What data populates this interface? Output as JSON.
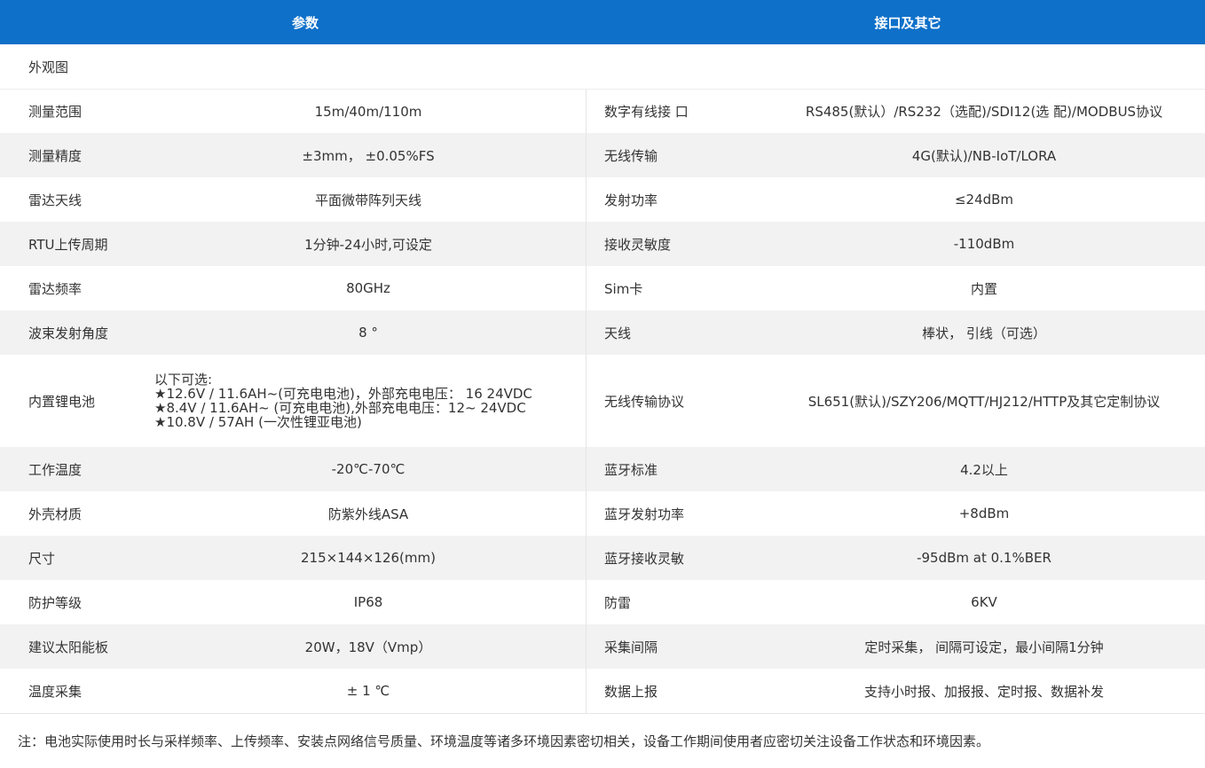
{
  "header": {
    "col1": "参数",
    "col2": "接口及其它"
  },
  "appearance_label": "外观图",
  "rows": [
    {
      "p": "测量范围",
      "v": "15m/40m/110m",
      "i": "数字有线接 口",
      "iv": "RS485(默认）/RS232（选配)/SDI12(选 配)/MODBUS协议"
    },
    {
      "p": "测量精度",
      "v": "±3mm， ±0.05%FS",
      "i": "无线传输",
      "iv": "4G(默认)/NB-IoT/LORA"
    },
    {
      "p": "雷达天线",
      "v": "平面微带阵列天线",
      "i": "发射功率",
      "iv": "≤24dBm"
    },
    {
      "p": "RTU上传周期",
      "v": "1分钟-24小时,可设定",
      "i": "接收灵敏度",
      "iv": "-110dBm"
    },
    {
      "p": "雷达频率",
      "v": "80GHz",
      "i": "Sim卡",
      "iv": "内置"
    },
    {
      "p": "波束发射角度",
      "v": "8 °",
      "i": "天线",
      "iv": "棒状， 引线（可选）"
    }
  ],
  "battery": {
    "p": "内置锂电池",
    "lines": [
      "以下可选:",
      "★12.6V / 11.6AH~(可充电电池)，外部充电电压： 16 24VDC",
      "★8.4V / 11.6AH~ (可充电电池),外部充电电压：12~ 24VDC",
      "★10.8V / 57AH (一次性锂亚电池)"
    ],
    "i": "无线传输协议",
    "iv": "SL651(默认)/SZY206/MQTT/HJ212/HTTP及其它定制协议"
  },
  "rows2": [
    {
      "p": "工作温度",
      "v": "-20℃-70℃",
      "i": "蓝牙标准",
      "iv": "4.2以上"
    },
    {
      "p": "外壳材质",
      "v": "防紫外线ASA",
      "i": "蓝牙发射功率",
      "iv": "+8dBm"
    },
    {
      "p": "尺寸",
      "v": "215×144×126(mm)",
      "i": "蓝牙接收灵敏",
      "iv": "-95dBm at 0.1%BER"
    },
    {
      "p": "防护等级",
      "v": "IP68",
      "i": "防雷",
      "iv": "6KV"
    },
    {
      "p": "建议太阳能板",
      "v": "20W，18V（Vmp）",
      "i": "采集间隔",
      "iv": "定时采集， 间隔可设定，最小间隔1分钟"
    },
    {
      "p": "温度采集",
      "v": "± 1 ℃",
      "i": "数据上报",
      "iv": "支持小时报、加报报、定时报、数据补发"
    }
  ],
  "note": "注：电池实际使用时长与采样频率、上传频率、安装点网络信号质量、环境温度等诸多环境因素密切相关，设备工作期间使用者应密切关注设备工作状态和环境因素。"
}
